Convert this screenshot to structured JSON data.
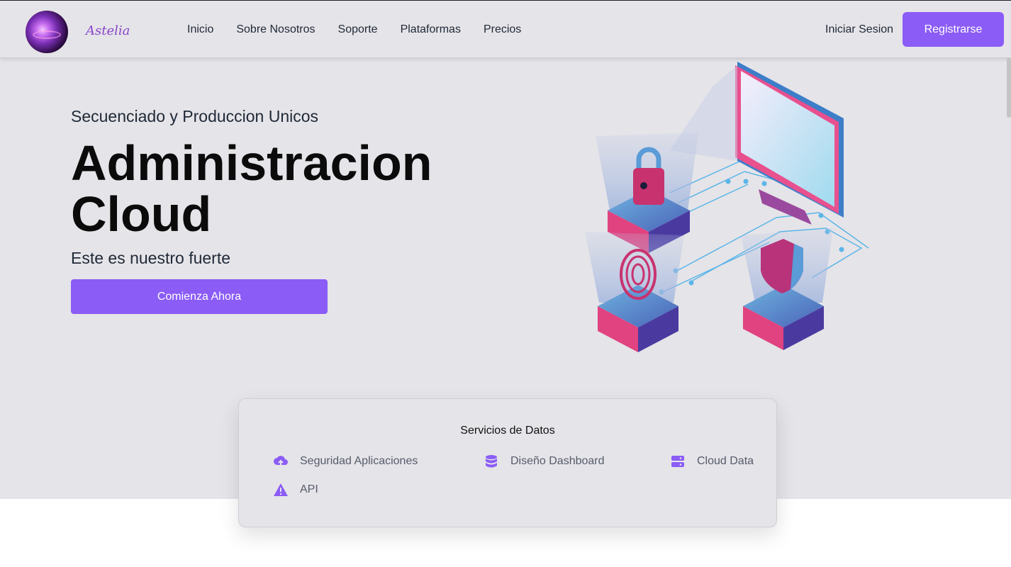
{
  "brand": {
    "name": "Astelia"
  },
  "nav": {
    "items": [
      "Inicio",
      "Sobre Nosotros",
      "Soporte",
      "Plataformas",
      "Precios"
    ]
  },
  "auth": {
    "login": "Iniciar Sesion",
    "register": "Registrarse"
  },
  "hero": {
    "subtitle": "Secuenciado y Produccion Unicos",
    "title_line1": "Administracion",
    "title_line2": "Cloud",
    "tagline": "Este es nuestro fuerte",
    "cta": "Comienza Ahora"
  },
  "services": {
    "title": "Servicios de Datos",
    "items": [
      {
        "label": "Seguridad Aplicaciones",
        "icon": "cloud-upload-icon"
      },
      {
        "label": "Diseño Dashboard",
        "icon": "database-icon"
      },
      {
        "label": "Cloud Data",
        "icon": "server-icon"
      },
      {
        "label": "API",
        "icon": "triangle-warning-icon"
      }
    ]
  },
  "colors": {
    "accent": "#8b5cf6",
    "background": "#e5e4e8"
  }
}
